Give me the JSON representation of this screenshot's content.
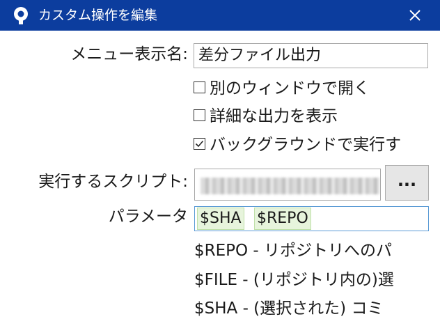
{
  "window": {
    "title": "カスタム操作を編集",
    "title_bar_color": "#0c3d9e",
    "icons": {
      "app": "sourcetree-icon",
      "close": "close-icon"
    }
  },
  "form": {
    "menu_name": {
      "label": "メニュー表示名:",
      "value": "差分ファイル出力"
    },
    "options": [
      {
        "label": "別のウィンドウで開く",
        "checked": false
      },
      {
        "label": "詳細な出力を表示",
        "checked": false
      },
      {
        "label": "バックグラウンドで実行す",
        "checked": true
      }
    ],
    "script": {
      "label": "実行するスクリプト:",
      "browse_label": "..."
    },
    "parameters": {
      "label": "パラメータ",
      "tokens": [
        "$SHA",
        "$REPO"
      ]
    },
    "help_lines": [
      "$REPO - リポジトリへのパ",
      "$FILE - (リポジトリ内の)選",
      "$SHA - (選択された) コミ"
    ]
  }
}
